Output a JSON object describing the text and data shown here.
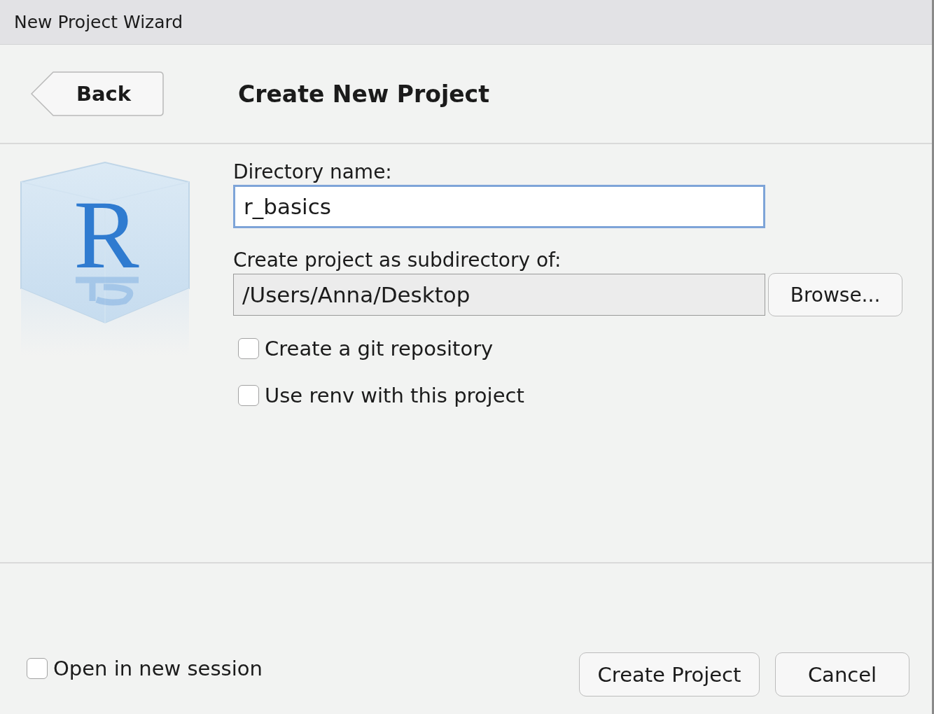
{
  "window": {
    "title": "New Project Wizard"
  },
  "logo": {
    "letter": "R"
  },
  "back_button": "Back",
  "heading": "Create New Project",
  "directory": {
    "label": "Directory name:",
    "value": "r_basics",
    "focused": true
  },
  "parent": {
    "label": "Create project as subdirectory of:",
    "value": "/Users/Anna/Desktop",
    "browse": "Browse..."
  },
  "options": [
    {
      "label": "Create a git repository",
      "checked": false
    },
    {
      "label": "Use renv with this project",
      "checked": false
    }
  ],
  "footer": {
    "new_session": {
      "label": "Open in new session",
      "checked": false
    },
    "buttons": [
      "Create Project",
      "Cancel"
    ]
  }
}
